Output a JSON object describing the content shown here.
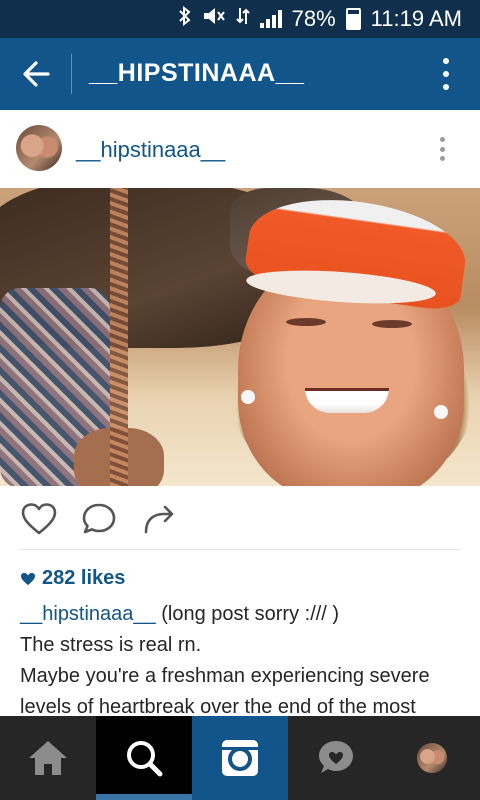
{
  "status_bar": {
    "battery": "78%",
    "time": "11:19 AM",
    "icons": [
      "bluetooth-icon",
      "mute-icon",
      "data-icon",
      "signal-icon",
      "battery-icon"
    ]
  },
  "app_bar": {
    "title": "__HIPSTINAAA__",
    "icons": [
      "back-arrow-icon",
      "overflow-menu-icon"
    ]
  },
  "post": {
    "username": "__hipstinaaa__",
    "likes": "282 likes",
    "caption_username": "__hipstinaaa__",
    "caption_line1": " (long post sorry :/// )",
    "caption_line2": "The stress is real rn.",
    "caption_line3": "Maybe you're a freshman experiencing severe levels of heartbreak over the end of the most"
  },
  "bottom_nav": {
    "items": [
      "home",
      "search",
      "camera",
      "activity",
      "profile"
    ],
    "active": "search"
  },
  "colors": {
    "status_bar": "#0f2f4d",
    "app_bar": "#12558a",
    "link": "#125688",
    "nav_bg": "#262626"
  }
}
